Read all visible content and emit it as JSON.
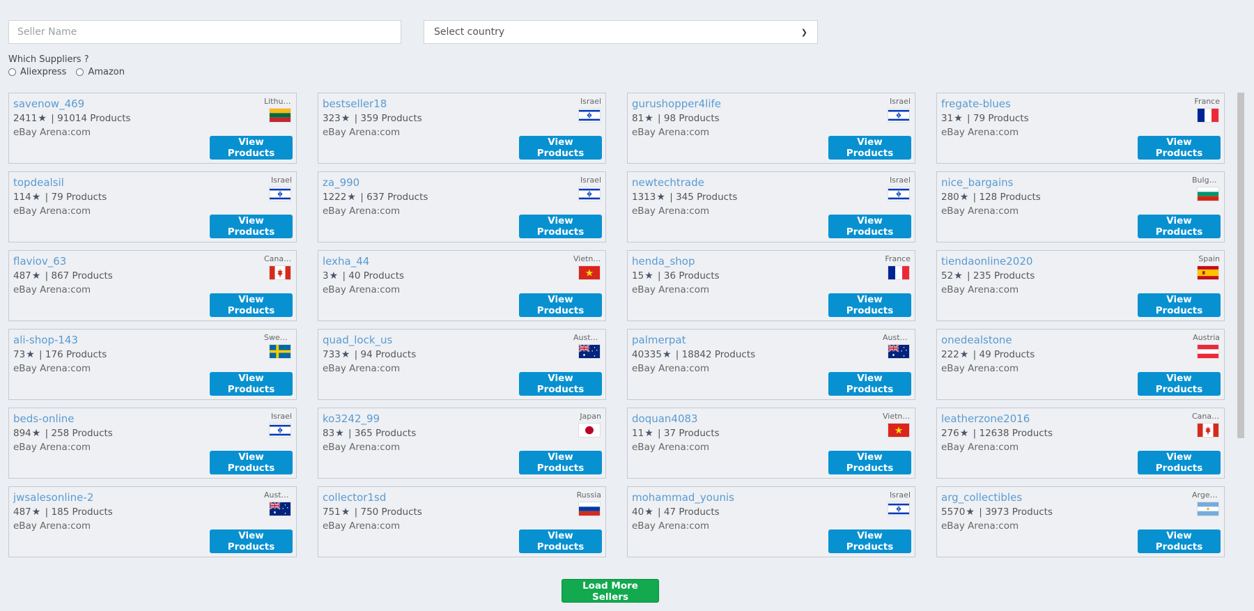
{
  "filters": {
    "seller_placeholder": "Seller Name",
    "country_select": "Select country"
  },
  "suppliers": {
    "question": "Which Suppliers ?",
    "options": [
      "Aliexpress",
      "Amazon"
    ]
  },
  "view_label": "View Products",
  "load_more_label": "Load More Sellers",
  "sellers": [
    {
      "name": "savenow_469",
      "rating": "2411",
      "products": "91014 Products",
      "source": "eBay Arena:com",
      "country": "Lithuania",
      "flag": "lt"
    },
    {
      "name": "bestseller18",
      "rating": "323",
      "products": "359 Products",
      "source": "eBay Arena:com",
      "country": "Israel",
      "flag": "il"
    },
    {
      "name": "gurushopper4life",
      "rating": "81",
      "products": "98 Products",
      "source": "eBay Arena:com",
      "country": "Israel",
      "flag": "il"
    },
    {
      "name": "fregate-blues",
      "rating": "31",
      "products": "79 Products",
      "source": "eBay Arena:com",
      "country": "France",
      "flag": "fr"
    },
    {
      "name": "topdealsil",
      "rating": "114",
      "products": "79 Products",
      "source": "eBay Arena:com",
      "country": "Israel",
      "flag": "il"
    },
    {
      "name": "za_990",
      "rating": "1222",
      "products": "637 Products",
      "source": "eBay Arena:com",
      "country": "Israel",
      "flag": "il"
    },
    {
      "name": "newtechtrade",
      "rating": "1313",
      "products": "345 Products",
      "source": "eBay Arena:com",
      "country": "Israel",
      "flag": "il"
    },
    {
      "name": "nice_bargains",
      "rating": "280",
      "products": "128 Products",
      "source": "eBay Arena:com",
      "country": "Bulgaria",
      "flag": "bg"
    },
    {
      "name": "flaviov_63",
      "rating": "487",
      "products": "867 Products",
      "source": "eBay Arena:com",
      "country": "Canada",
      "flag": "ca"
    },
    {
      "name": "lexha_44",
      "rating": "3",
      "products": "40 Products",
      "source": "eBay Arena:com",
      "country": "Vietnam",
      "flag": "vn"
    },
    {
      "name": "henda_shop",
      "rating": "15",
      "products": "36 Products",
      "source": "eBay Arena:com",
      "country": "France",
      "flag": "fr"
    },
    {
      "name": "tiendaonline2020",
      "rating": "52",
      "products": "235 Products",
      "source": "eBay Arena:com",
      "country": "Spain",
      "flag": "es"
    },
    {
      "name": "ali-shop-143",
      "rating": "73",
      "products": "176 Products",
      "source": "eBay Arena:com",
      "country": "Sweden",
      "flag": "se"
    },
    {
      "name": "quad_lock_us",
      "rating": "733",
      "products": "94 Products",
      "source": "eBay Arena:com",
      "country": "Australia",
      "flag": "au"
    },
    {
      "name": "palmerpat",
      "rating": "40335",
      "products": "18842 Products",
      "source": "eBay Arena:com",
      "country": "Australia",
      "flag": "au"
    },
    {
      "name": "onedealstone",
      "rating": "222",
      "products": "49 Products",
      "source": "eBay Arena:com",
      "country": "Austria",
      "flag": "at"
    },
    {
      "name": "beds-online",
      "rating": "894",
      "products": "258 Products",
      "source": "eBay Arena:com",
      "country": "Israel",
      "flag": "il"
    },
    {
      "name": "ko3242_99",
      "rating": "83",
      "products": "365 Products",
      "source": "eBay Arena:com",
      "country": "Japan",
      "flag": "jp"
    },
    {
      "name": "doquan4083",
      "rating": "11",
      "products": "37 Products",
      "source": "eBay Arena:com",
      "country": "Vietnam",
      "flag": "vn"
    },
    {
      "name": "leatherzone2016",
      "rating": "276",
      "products": "12638 Products",
      "source": "eBay Arena:com",
      "country": "Canada",
      "flag": "ca"
    },
    {
      "name": "jwsalesonline-2",
      "rating": "487",
      "products": "185 Products",
      "source": "eBay Arena:com",
      "country": "Australia",
      "flag": "au"
    },
    {
      "name": "collector1sd",
      "rating": "751",
      "products": "750 Products",
      "source": "eBay Arena:com",
      "country": "Russia",
      "flag": "ru"
    },
    {
      "name": "mohammad_younis",
      "rating": "40",
      "products": "47 Products",
      "source": "eBay Arena:com",
      "country": "Israel",
      "flag": "il"
    },
    {
      "name": "arg_collectibles",
      "rating": "5570",
      "products": "3973 Products",
      "source": "eBay Arena:com",
      "country": "Argentina",
      "flag": "ar"
    }
  ]
}
